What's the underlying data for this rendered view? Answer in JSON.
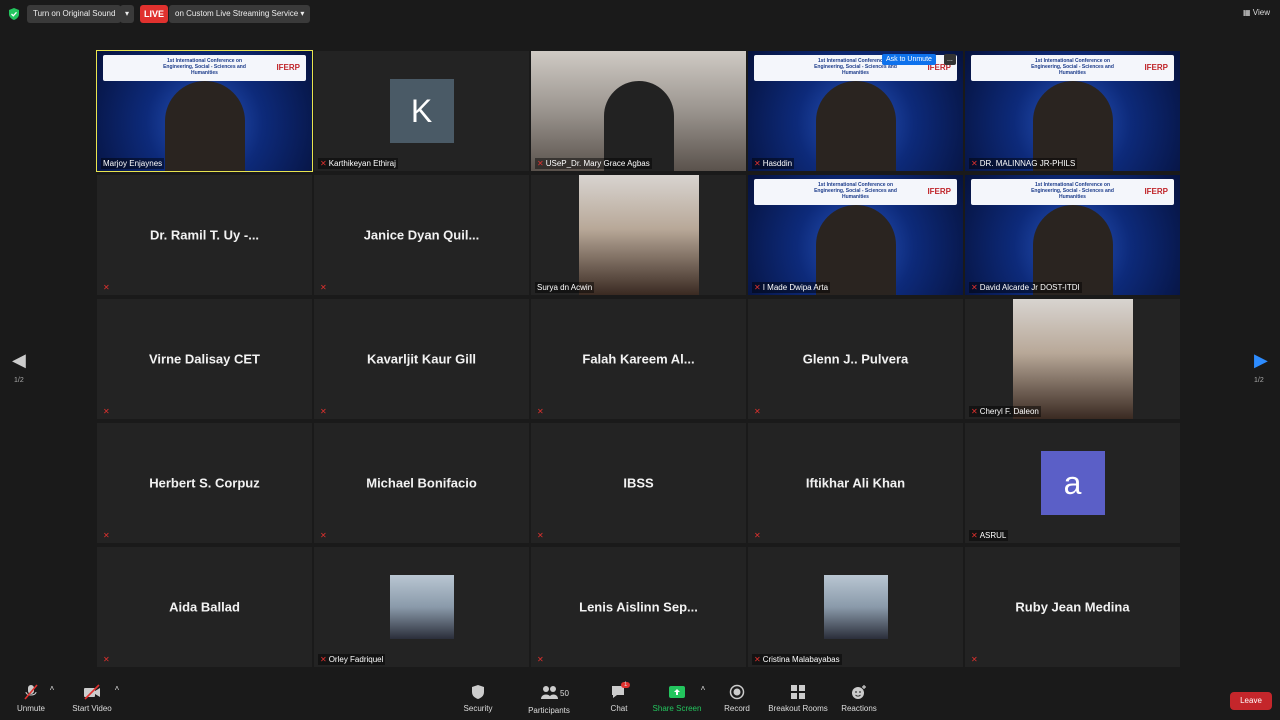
{
  "topbar": {
    "sound_label": "Turn on Original Sound",
    "live_label": "LIVE",
    "stream_label": "on Custom Live Streaming Service",
    "view_label": "View"
  },
  "tiles": [
    {
      "name": "Marjoy Enjaynes",
      "label": "Marjoy Enjaynes",
      "type": "video",
      "muted": false
    },
    {
      "name": "Karthikeyan Ethiraj",
      "label": "Karthikeyan Ethiraj",
      "type": "avatar",
      "avatar_letter": "K",
      "avatar_color": "#4a5a66",
      "muted": true
    },
    {
      "name": "USeP_Dr. Mary Grace Agbas",
      "label": "USeP_Dr. Mary Grace Agbas",
      "type": "video",
      "muted": true
    },
    {
      "name": "Hasddin",
      "label": "Hasddin",
      "type": "video",
      "muted": true
    },
    {
      "name": "DR. MALINNAG JR-PHILS",
      "label": "DR. MALINNAG JR-PHILS",
      "type": "video",
      "muted": true
    },
    {
      "name": "Dr. Ramil T. Uy -...",
      "label": "",
      "type": "name",
      "muted": true
    },
    {
      "name": "Janice Dyan Quil...",
      "label": "",
      "type": "name",
      "muted": true
    },
    {
      "name": "Surya dn Acwin",
      "label": "Surya dn Acwin",
      "type": "photo",
      "muted": false
    },
    {
      "name": "I Made Dwipa Arta",
      "label": "I Made Dwipa Arta",
      "type": "video",
      "muted": true
    },
    {
      "name": "David Alcarde Jr DOST-ITDI",
      "label": "David Alcarde Jr DOST-ITDI",
      "type": "video",
      "muted": true
    },
    {
      "name": "Virne Dalisay CET",
      "label": "",
      "type": "name",
      "muted": true
    },
    {
      "name": "Kavarljit Kaur Gill",
      "label": "",
      "type": "name",
      "muted": true
    },
    {
      "name": "Falah Kareem Al...",
      "label": "",
      "type": "name",
      "muted": true
    },
    {
      "name": "Glenn J.. Pulvera",
      "label": "",
      "type": "name",
      "muted": true
    },
    {
      "name": "Cheryl F. Daleon",
      "label": "Cheryl F. Daleon",
      "type": "photo",
      "muted": true
    },
    {
      "name": "Herbert S. Corpuz",
      "label": "",
      "type": "name",
      "muted": true
    },
    {
      "name": "Michael Bonifacio",
      "label": "",
      "type": "name",
      "muted": true
    },
    {
      "name": "IBSS",
      "label": "",
      "type": "name",
      "muted": true
    },
    {
      "name": "Iftikhar Ali Khan",
      "label": "",
      "type": "name",
      "muted": true
    },
    {
      "name": "ASRUL",
      "label": "ASRUL",
      "type": "avatar",
      "avatar_letter": "a",
      "avatar_color": "#5b5fc7",
      "muted": true
    },
    {
      "name": "Aida Ballad",
      "label": "",
      "type": "name",
      "muted": true
    },
    {
      "name": "Orley Fadriquel",
      "label": "Orley Fadriquel",
      "type": "smallphoto",
      "muted": true
    },
    {
      "name": "Lenis Aislinn Sep...",
      "label": "",
      "type": "name",
      "muted": true
    },
    {
      "name": "Cristina Malabayabas",
      "label": "Cristina Malabayabas",
      "type": "smallphoto",
      "muted": true
    },
    {
      "name": "Ruby Jean Medina",
      "label": "",
      "type": "name",
      "muted": true
    }
  ],
  "overlay": {
    "ask_unmute": "Ask to Unmute",
    "dots": "...",
    "conference_title": "1st International Conference on Engineering, Social - Sciences and Humanities",
    "conference_brand": "IFERP"
  },
  "pagination": {
    "left": "1/2",
    "right": "1/2"
  },
  "toolbar": {
    "unmute": "Unmute",
    "start_video": "Start Video",
    "security": "Security",
    "participants": "Participants",
    "participants_count": "50",
    "chat": "Chat",
    "chat_badge": "1",
    "share_screen": "Share Screen",
    "record": "Record",
    "breakout": "Breakout Rooms",
    "reactions": "Reactions",
    "leave": "Leave"
  },
  "colors": {
    "active_border": "#e8e44f",
    "leave": "#c4262b",
    "share": "#23c55e",
    "live": "#e0312e"
  }
}
